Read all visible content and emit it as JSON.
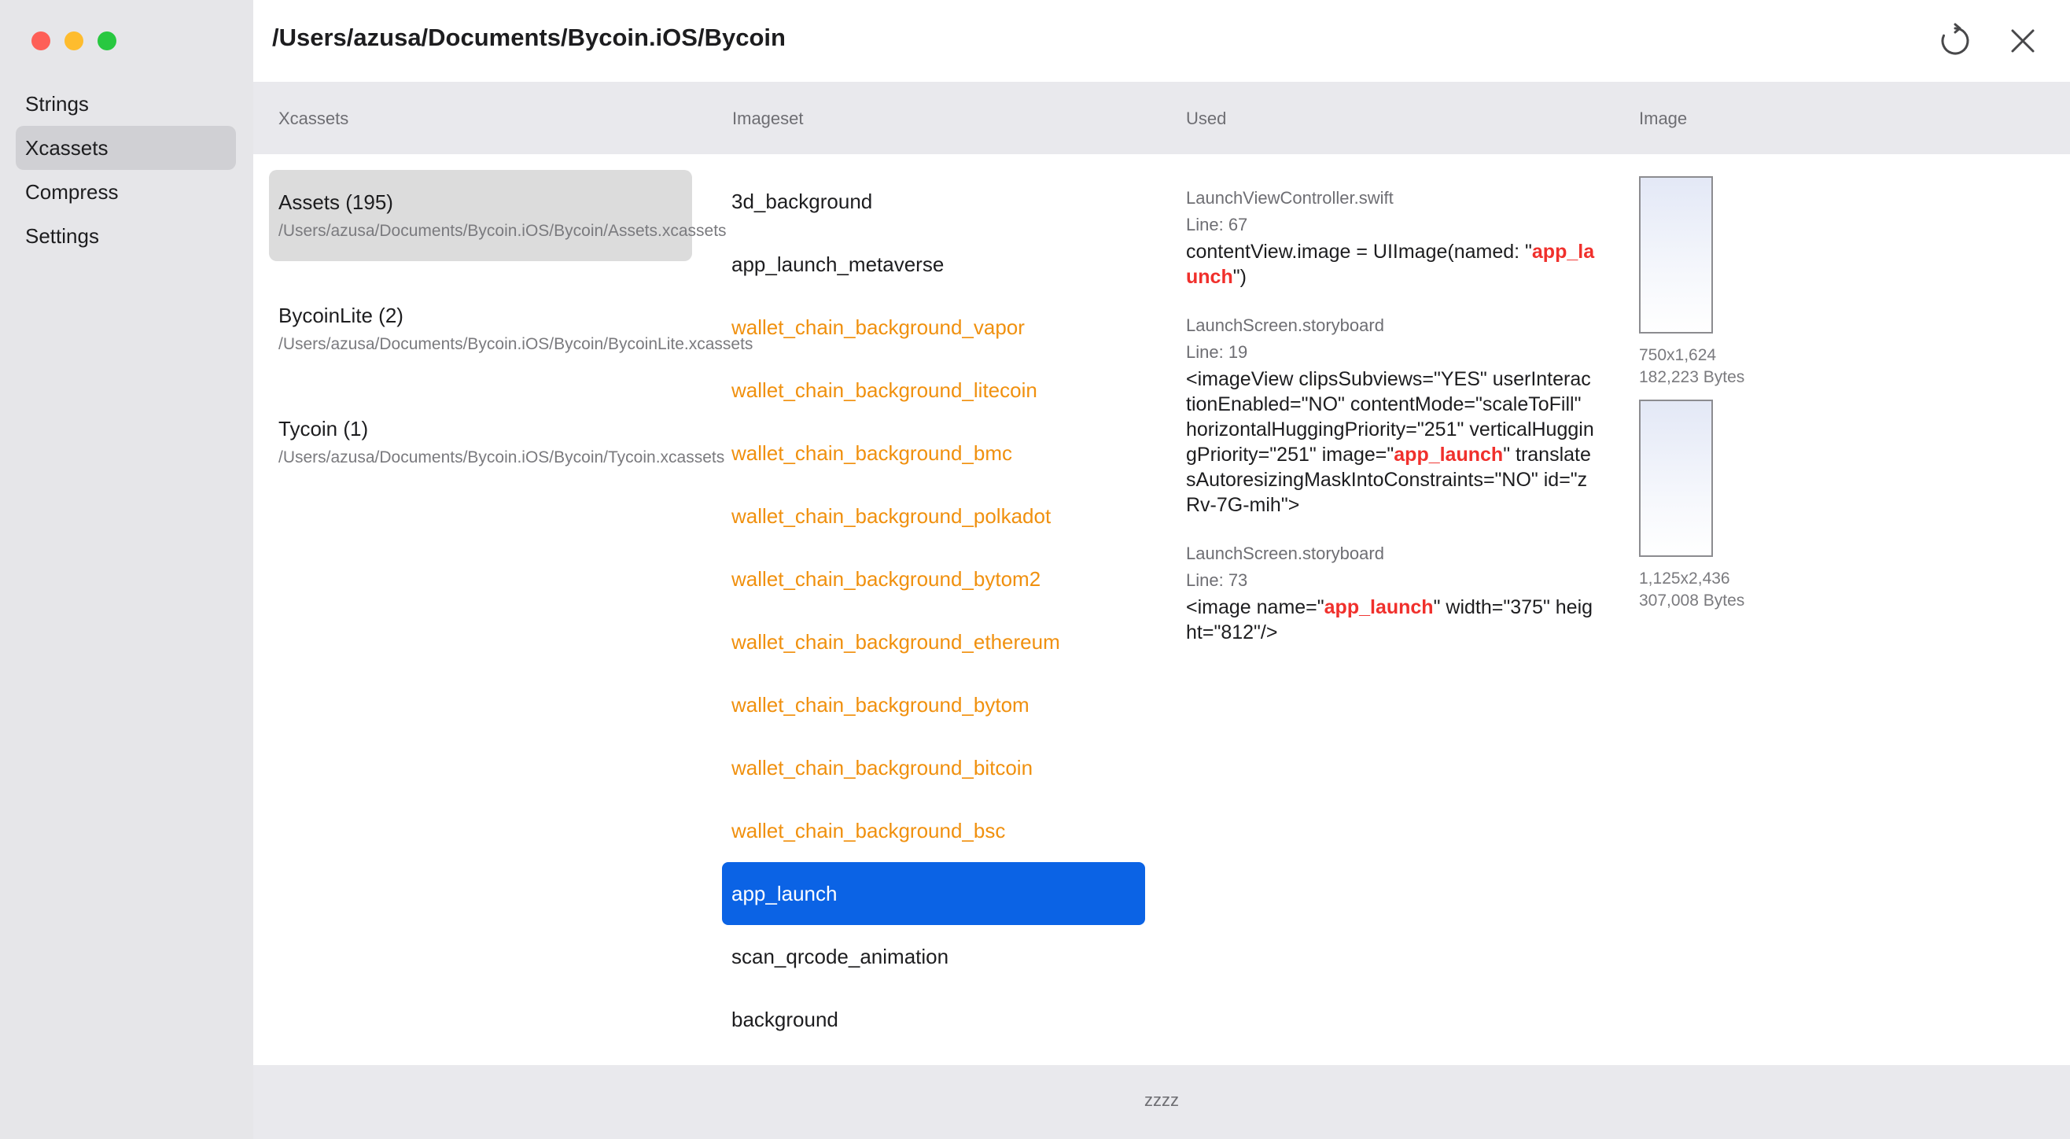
{
  "window": {
    "title": "/Users/azusa/Documents/Bycoin.iOS/Bycoin",
    "traffic_lights": {
      "close_color": "#fe5f57",
      "minimize_color": "#febc2e",
      "maximize_color": "#28c840"
    },
    "toolbar_icons": {
      "refresh": "refresh-icon",
      "close": "close-icon"
    }
  },
  "sidebar": {
    "items": [
      {
        "label": "Strings",
        "selected": false
      },
      {
        "label": "Xcassets",
        "selected": true
      },
      {
        "label": "Compress",
        "selected": false
      },
      {
        "label": "Settings",
        "selected": false
      }
    ]
  },
  "columns": {
    "xcassets": "Xcassets",
    "imageset": "Imageset",
    "used": "Used",
    "image": "Image"
  },
  "xcassets": [
    {
      "name": "Assets (195)",
      "path": "/Users/azusa/Documents/Bycoin.iOS/Bycoin/Assets.xcassets",
      "selected": true
    },
    {
      "name": "BycoinLite (2)",
      "path": "/Users/azusa/Documents/Bycoin.iOS/Bycoin/BycoinLite.xcassets",
      "selected": false
    },
    {
      "name": "Tycoin (1)",
      "path": "/Users/azusa/Documents/Bycoin.iOS/Bycoin/Tycoin.xcassets",
      "selected": false
    }
  ],
  "imagesets": [
    {
      "label": "3d_background",
      "state": "used"
    },
    {
      "label": "app_launch_metaverse",
      "state": "used"
    },
    {
      "label": "wallet_chain_background_vapor",
      "state": "unused"
    },
    {
      "label": "wallet_chain_background_litecoin",
      "state": "unused"
    },
    {
      "label": "wallet_chain_background_bmc",
      "state": "unused"
    },
    {
      "label": "wallet_chain_background_polkadot",
      "state": "unused"
    },
    {
      "label": "wallet_chain_background_bytom2",
      "state": "unused"
    },
    {
      "label": "wallet_chain_background_ethereum",
      "state": "unused"
    },
    {
      "label": "wallet_chain_background_bytom",
      "state": "unused"
    },
    {
      "label": "wallet_chain_background_bitcoin",
      "state": "unused"
    },
    {
      "label": "wallet_chain_background_bsc",
      "state": "unused"
    },
    {
      "label": "app_launch",
      "state": "selected"
    },
    {
      "label": "scan_qrcode_animation",
      "state": "used"
    },
    {
      "label": "background",
      "state": "used"
    }
  ],
  "usages": [
    {
      "file": "LaunchViewController.swift",
      "line": "Line: 67",
      "code_before": "contentView.image = UIImage(named: \"",
      "code_highlight": "app_launch",
      "code_after": "\")"
    },
    {
      "file": "LaunchScreen.storyboard",
      "line": "Line: 19",
      "code_before": "<imageView clipsSubviews=\"YES\" userInteractionEnabled=\"NO\" contentMode=\"scaleToFill\" horizontalHuggingPriority=\"251\" verticalHuggingPriority=\"251\" image=\"",
      "code_highlight": "app_launch",
      "code_after": "\" translatesAutoresizingMaskIntoConstraints=\"NO\" id=\"zRv-7G-mih\">"
    },
    {
      "file": "LaunchScreen.storyboard",
      "line": "Line: 73",
      "code_before": "<image name=\"",
      "code_highlight": "app_launch",
      "code_after": "\" width=\"375\" height=\"812\"/>"
    }
  ],
  "images": [
    {
      "dimensions": "750x1,624",
      "size": "182,223 Bytes"
    },
    {
      "dimensions": "1,125x2,436",
      "size": "307,008 Bytes"
    }
  ],
  "footer": {
    "text": "zzzz"
  },
  "colors": {
    "accent": "#0b63e5",
    "unused": "#f0900e",
    "highlight": "#f0302c"
  }
}
